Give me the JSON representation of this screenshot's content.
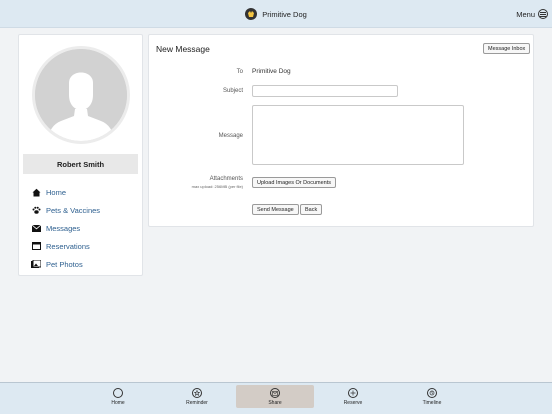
{
  "header": {
    "app_title": "Primitive Dog",
    "menu_label": "Menu",
    "logo_icon": "dog-logo-icon",
    "menu_icon": "menu-circle-icon"
  },
  "profile": {
    "name": "Robert Smith"
  },
  "sidebar": {
    "items": [
      {
        "label": "Home",
        "icon": "home-icon"
      },
      {
        "label": "Pets & Vaccines",
        "icon": "paw-icon"
      },
      {
        "label": "Messages",
        "icon": "envelope-icon"
      },
      {
        "label": "Reservations",
        "icon": "calendar-icon"
      },
      {
        "label": "Pet Photos",
        "icon": "photo-icon"
      }
    ]
  },
  "message_form": {
    "title": "New Message",
    "inbox_button": "Message Inbox",
    "to_label": "To",
    "to_value": "Primitive Dog",
    "subject_label": "Subject",
    "subject_value": "",
    "message_label": "Message",
    "message_value": "",
    "attachments_label": "Attachments",
    "attachments_hint": "max upload: 256MB (per file)",
    "upload_button": "Upload Images Or Documents",
    "send_button": "Send Message",
    "back_button": "Back"
  },
  "tabbar": {
    "tabs": [
      {
        "label": "Home",
        "icon": "home-circle-icon"
      },
      {
        "label": "Reminder",
        "icon": "reminder-icon"
      },
      {
        "label": "Share",
        "icon": "share-icon",
        "active": true
      },
      {
        "label": "Reserve",
        "icon": "plus-icon"
      },
      {
        "label": "Timeline",
        "icon": "timeline-icon"
      }
    ]
  }
}
